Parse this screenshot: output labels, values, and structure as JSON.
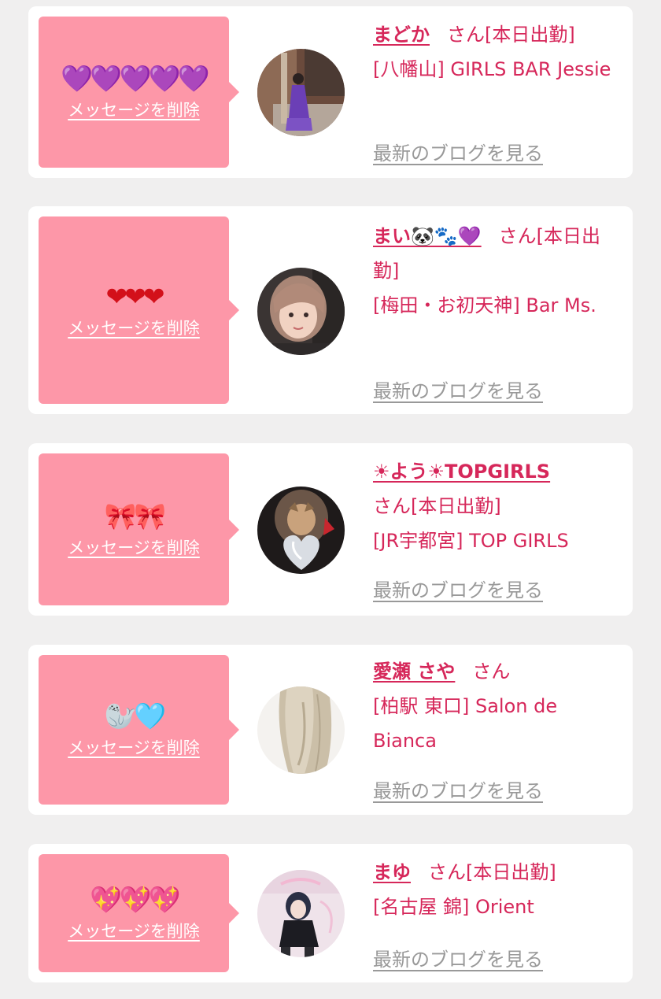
{
  "delete_label": "メッセージを削除",
  "blog_label": "最新のブログを見る",
  "honorific": "さん",
  "colors": {
    "page_bg": "#f0efef",
    "card_bg": "#ffffff",
    "bubble": "#fd97a8",
    "accent": "#d6275a",
    "link_gray": "#999999"
  },
  "cards": [
    {
      "emojis": "💜💜💜💜💜",
      "emoji_icons": [
        "purple-heart-icon",
        "purple-heart-icon",
        "purple-heart-icon",
        "purple-heart-icon",
        "purple-heart-icon"
      ],
      "name": "まどか",
      "status": "[本日出勤]",
      "location": "[八幡山] GIRLS BAR Jessie"
    },
    {
      "emojis": "❤❤❤",
      "emoji_icons": [
        "red-heart-icon",
        "red-heart-icon",
        "red-heart-icon"
      ],
      "name": "まい🐼🐾💜",
      "status": "[本日出勤]",
      "location": "[梅田・お初天神] Bar Ms."
    },
    {
      "emojis": "🎀🎀",
      "emoji_icons": [
        "ribbon-icon",
        "ribbon-icon"
      ],
      "name": "☀よう☀TOPGIRLS",
      "status": "[本日出勤]",
      "location": "[JR宇都宮] TOP GIRLS"
    },
    {
      "emojis": "🦭🩵",
      "emoji_icons": [
        "seal-icon",
        "light-blue-heart-icon"
      ],
      "name": "愛瀬 さや",
      "status": "",
      "location": "[柏駅 東口] Salon de Bianca"
    },
    {
      "emojis": "💖💖💖",
      "emoji_icons": [
        "sparkling-heart-icon",
        "sparkling-heart-icon",
        "sparkling-heart-icon"
      ],
      "name": "まゆ",
      "status": "[本日出勤]",
      "location": "[名古屋 錦] Orient"
    }
  ]
}
